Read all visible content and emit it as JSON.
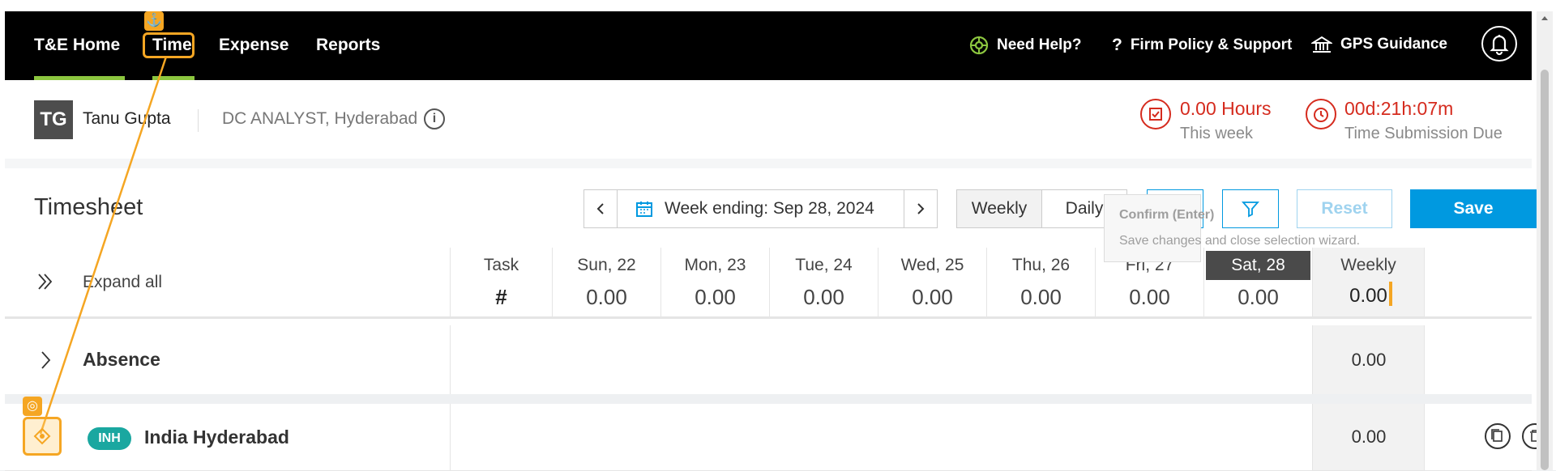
{
  "nav": {
    "items": [
      {
        "label": "T&E Home"
      },
      {
        "label": "Time"
      },
      {
        "label": "Expense"
      },
      {
        "label": "Reports"
      }
    ],
    "help": "Need Help?",
    "policy": "Firm Policy & Support",
    "gps": "GPS Guidance"
  },
  "user": {
    "initials": "TG",
    "name": "Tanu Gupta",
    "role": "DC ANALYST, Hyderabad"
  },
  "kpis": {
    "hours_value": "0.00 Hours",
    "hours_label": "This week",
    "due_value": "00d:21h:07m",
    "due_label": "Time Submission Due"
  },
  "timesheet": {
    "title": "Timesheet",
    "week_label": "Week ending: Sep 28, 2024",
    "view_weekly": "Weekly",
    "view_daily": "Daily",
    "reset": "Reset",
    "save": "Save",
    "tooltip_title": "Confirm (Enter)",
    "tooltip_body": "Save changes and close selection wizard."
  },
  "grid": {
    "expand_all": "Expand all",
    "task_header": "Task",
    "task_symbol": "#",
    "days": [
      {
        "label": "Sun, 22",
        "value": "0.00"
      },
      {
        "label": "Mon, 23",
        "value": "0.00"
      },
      {
        "label": "Tue, 24",
        "value": "0.00"
      },
      {
        "label": "Wed, 25",
        "value": "0.00"
      },
      {
        "label": "Thu, 26",
        "value": "0.00"
      },
      {
        "label": "Fri, 27",
        "value": "0.00"
      },
      {
        "label": "Sat, 28",
        "value": "0.00"
      }
    ],
    "weekly_header": "Weekly",
    "weekly_total": "0.00"
  },
  "rows": [
    {
      "label": "Absence",
      "total": "0.00"
    },
    {
      "badge": "INH",
      "label": "India Hyderabad",
      "total": "0.00"
    }
  ],
  "colors": {
    "nav_bg": "#000000",
    "accent_green": "#8cc63f",
    "alert_red": "#d52b1e",
    "primary_blue": "#0099e0",
    "badge_teal": "#1aa7a0",
    "annotation_orange": "#f5a623"
  }
}
